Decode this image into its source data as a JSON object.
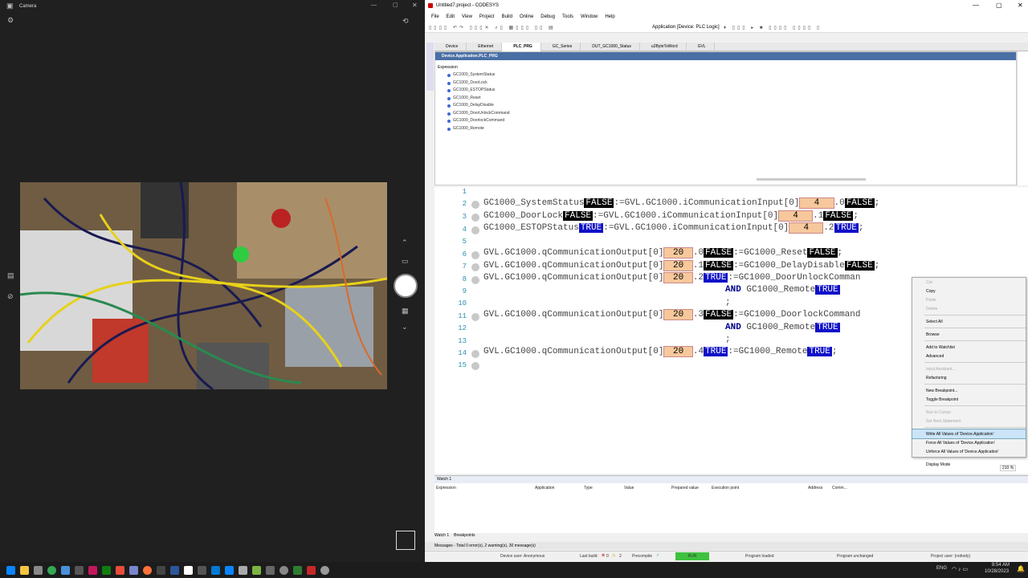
{
  "camera": {
    "title": "Camera"
  },
  "codesys": {
    "title": "Untitled7.project - CODESYS",
    "menu": [
      "File",
      "Edit",
      "View",
      "Project",
      "Build",
      "Online",
      "Debug",
      "Tools",
      "Window",
      "Help"
    ],
    "app_label": "Application [Device: PLC Logic]",
    "tabs": [
      "Device",
      "Ethernet",
      "PLC_PRG",
      "GC_Series",
      "DUT_GC1000_Status",
      "u2ByteToWord",
      "GVL"
    ],
    "decl_header": "Device.Application.PLC_PRG",
    "expr_label": "Expression",
    "variables": [
      "GC1000_SystemStatus",
      "GC1000_DoorLock",
      "GC1000_ESTOPStatus",
      "GC1000_Reset",
      "GC1000_DelayDisable",
      "GC1000_DoorUnlockCommand",
      "GC1000_DoorlockCommand",
      "GC1000_Remote"
    ],
    "context_menu": [
      {
        "label": "Cut",
        "dis": true
      },
      {
        "label": "Copy"
      },
      {
        "label": "Paste",
        "dis": true
      },
      {
        "label": "Delete",
        "dis": true
      },
      {
        "sep": true
      },
      {
        "label": "Select All"
      },
      {
        "sep": true
      },
      {
        "label": "Browse"
      },
      {
        "sep": true
      },
      {
        "label": "Add to Watchlist"
      },
      {
        "label": "Advanced"
      },
      {
        "sep": true
      },
      {
        "label": "Input Assistant...",
        "dis": true
      },
      {
        "label": "Refactoring"
      },
      {
        "sep": true
      },
      {
        "label": "New Breakpoint..."
      },
      {
        "label": "Toggle Breakpoint"
      },
      {
        "sep": true
      },
      {
        "label": "Run to Cursor",
        "dis": true
      },
      {
        "label": "Set Next Statement",
        "dis": true
      },
      {
        "sep": true
      },
      {
        "label": "Write All Values of 'Device.Application'",
        "hl": true
      },
      {
        "label": "Force All Values of 'Device.Application'"
      },
      {
        "label": "Unforce All Values of 'Device.Application'"
      },
      {
        "sep": true
      },
      {
        "label": "Display Mode"
      }
    ],
    "zoom": "210 %",
    "watch_title": "Watch 1",
    "watch_cols": [
      "Expression",
      "Application",
      "Type",
      "Value",
      "Prepared value",
      "Execution point",
      "Address",
      "Comm..."
    ],
    "watch_tabs": [
      "Watch 1",
      "Breakpoints"
    ],
    "messages": "Messages - Total 0 error(s), 2 warning(s), 30 message(s)",
    "status": {
      "user": "Device user: Anonymous",
      "lastbuild": "Last build:",
      "errors": "0",
      "warnings": "2",
      "precompile": "Precompile",
      "run": "RUN",
      "loaded": "Program loaded",
      "unchanged": "Program unchanged",
      "project_user": "Project user: (nobody)"
    }
  },
  "taskbar": {
    "lang": "ENG",
    "time": "8:54 AM",
    "date": "10/28/2023"
  }
}
